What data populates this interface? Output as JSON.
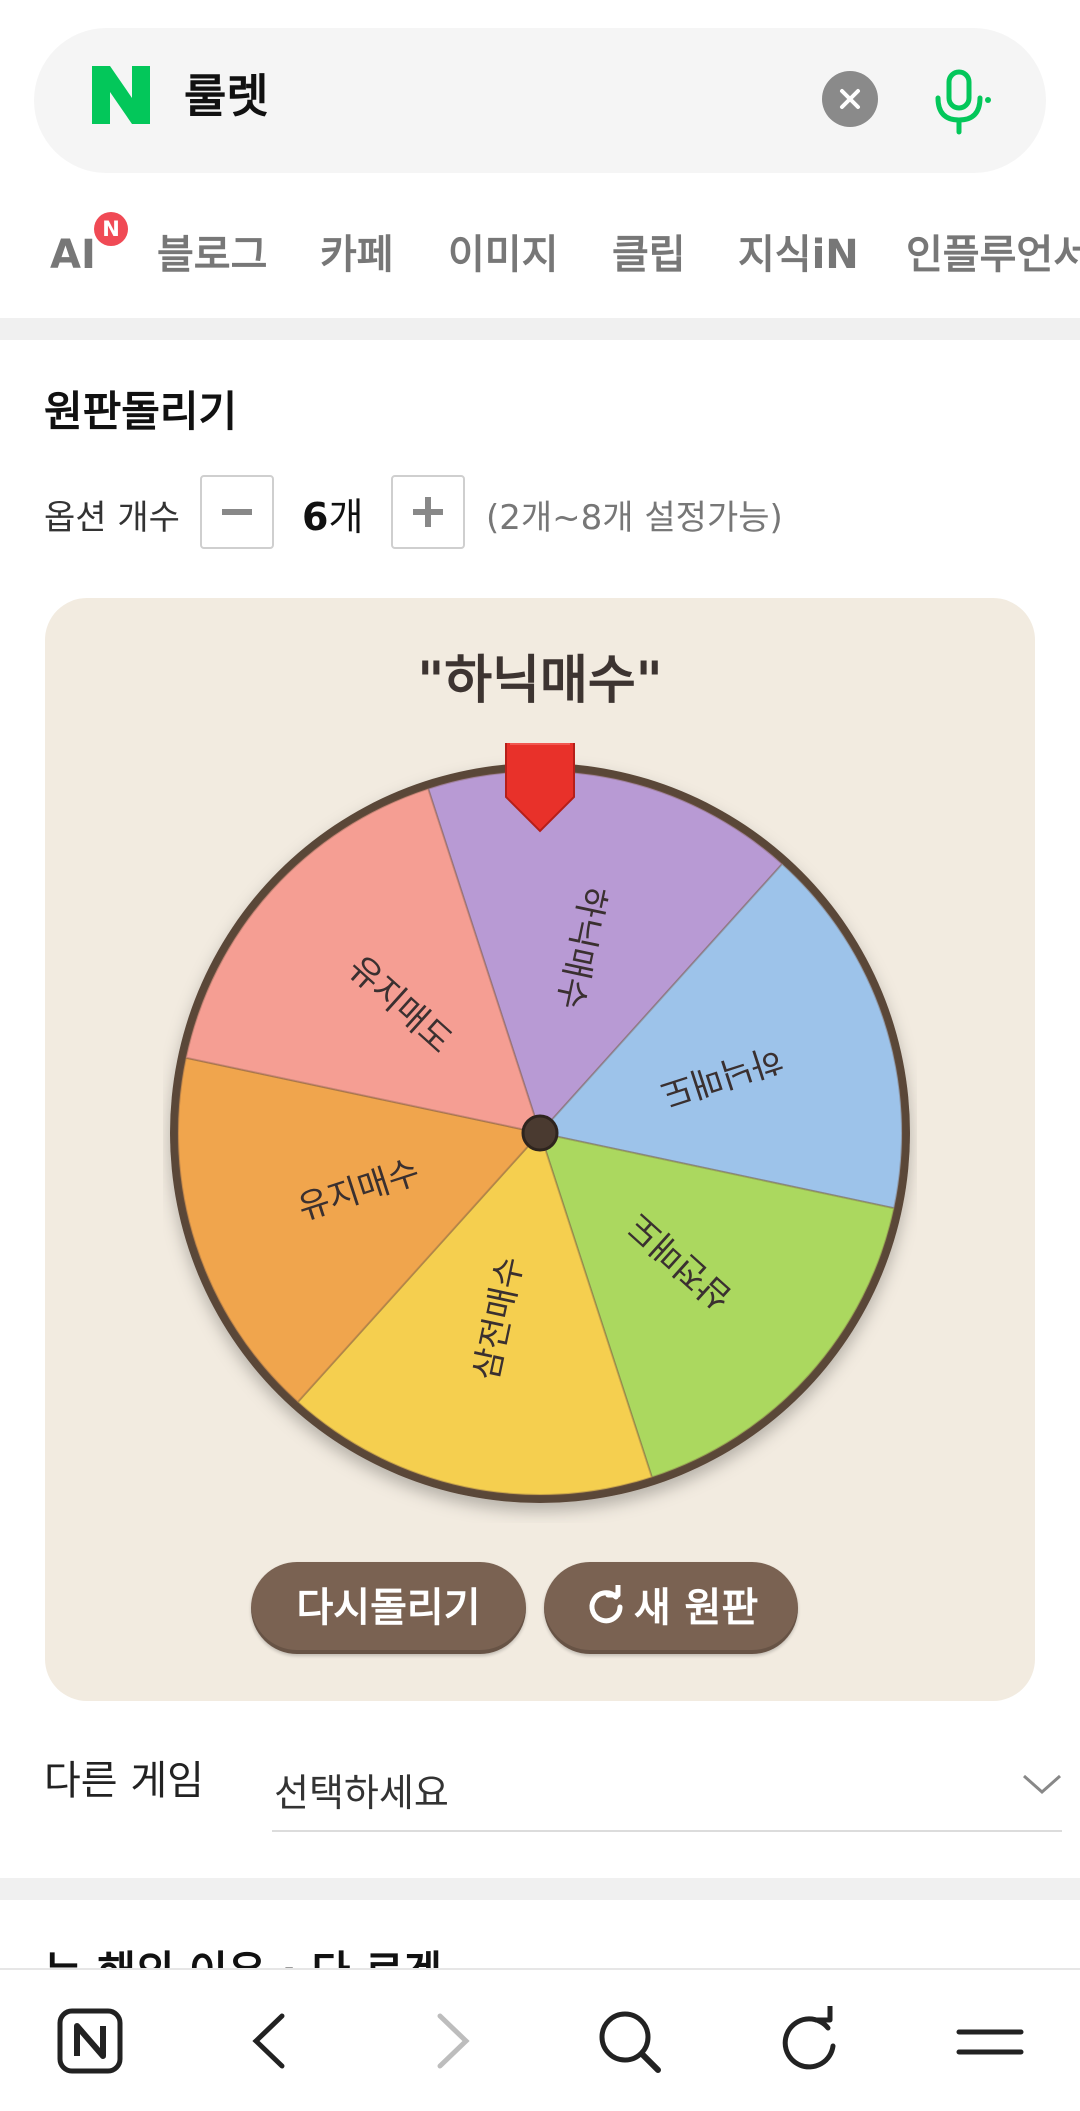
{
  "search": {
    "query": "룰렛",
    "brand": "N"
  },
  "tabs": [
    {
      "label": "AI",
      "badge": "N"
    },
    {
      "label": "블로그"
    },
    {
      "label": "카페"
    },
    {
      "label": "이미지"
    },
    {
      "label": "클립"
    },
    {
      "label": "지식iN"
    },
    {
      "label": "인플루언서"
    }
  ],
  "section": {
    "title": "원판돌리기",
    "option_label": "옵션 개수",
    "option_count": "6",
    "option_unit": "개",
    "option_hint": "(2개~8개 설정가능)",
    "minus": "−",
    "plus": "+"
  },
  "roulette": {
    "title": "\"하닉매수\"",
    "segments": [
      {
        "label": "하닉매수",
        "color": "#b89ad4"
      },
      {
        "label": "하닉매도",
        "color": "#9dc3ea"
      },
      {
        "label": "삼전매도",
        "color": "#abd85f"
      },
      {
        "label": "삼전매수",
        "color": "#f5cf4f"
      },
      {
        "label": "유지매수",
        "color": "#f0a54d"
      },
      {
        "label": "유지매도",
        "color": "#f59e93"
      }
    ],
    "respin_label": "다시돌리기",
    "new_label": "새 원판",
    "rim_color": "#5a4638",
    "pointer_color": "#e8312a"
  },
  "other_game": {
    "label": "다른 게임",
    "placeholder": "선택하세요"
  },
  "peek": {
    "text": "누 해의 이유 · 다 로겐"
  },
  "colors": {
    "brand_green": "#03c75a",
    "badge_red": "#f04a55",
    "button_brown": "#7a6252"
  }
}
